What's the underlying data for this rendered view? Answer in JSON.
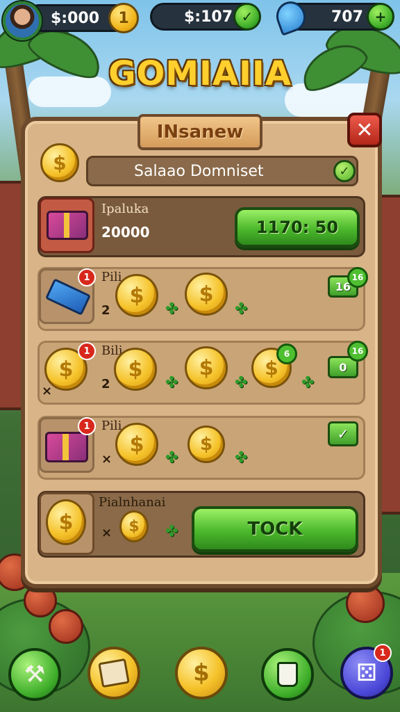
{
  "hud": {
    "coins_value": "$:000",
    "cash_value": "$:107",
    "gems_value": "707",
    "coin_btn_symbol": "1",
    "cash_check_symbol": "✓",
    "gems_btn_symbol": "+"
  },
  "game_title": "GOMIAIIA",
  "panel": {
    "banner_title": "INsanew",
    "close_symbol": "✕",
    "name_bar_text": "Salaao Domniset",
    "name_check_symbol": "✓",
    "featured": {
      "label": "Ipaluka",
      "amount": "20000",
      "button_label": "1170: 50"
    },
    "rows": [
      {
        "label": "Pili",
        "badge": "1",
        "qty": "2",
        "side_button": "16",
        "side_badge": "16"
      },
      {
        "label": "Bili",
        "badge": "1",
        "qty": "2",
        "side_button": "0",
        "side_badge": "16",
        "coin_badge": "6"
      },
      {
        "label": "Pili",
        "badge": "1",
        "qty": "×",
        "side_check": "✓"
      }
    ],
    "bottom_row": {
      "label": "Pialnhanai",
      "qty": "×",
      "button_label": "TOCK"
    },
    "multiplier_symbol": "×",
    "clover_symbol": "✤",
    "coin_symbol": "$"
  },
  "nav": {
    "left_symbol": "⚒",
    "right_badge": "1",
    "dice_symbol": "⚄",
    "coin_symbol": "$",
    "check_symbol": "✓"
  },
  "colors": {
    "panel_bg": "#d9b488",
    "panel_border": "#6e4a2c",
    "accent_green": "#4cb82c",
    "accent_gold": "#f5c22a",
    "close_red": "#d8281c"
  }
}
